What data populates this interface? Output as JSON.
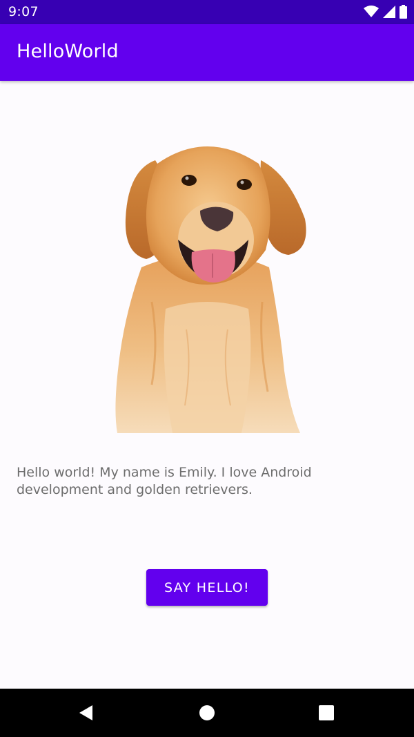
{
  "status_bar": {
    "time": "9:07",
    "icons": [
      "wifi-icon",
      "cellular-signal-icon",
      "battery-icon"
    ]
  },
  "app_bar": {
    "title": "HelloWorld",
    "color": "#6200ee"
  },
  "content": {
    "image": "golden-retriever-photo",
    "description": "Hello world! My name is Emily. I love Android development and golden retrievers.",
    "button_label": "SAY HELLO!"
  },
  "nav_bar": {
    "buttons": [
      "back-icon",
      "home-icon",
      "recents-icon"
    ]
  },
  "colors": {
    "status_bar": "#3700b3",
    "primary": "#6200ee",
    "background": "#fdfbfe",
    "text_secondary": "#6d6d6d"
  }
}
